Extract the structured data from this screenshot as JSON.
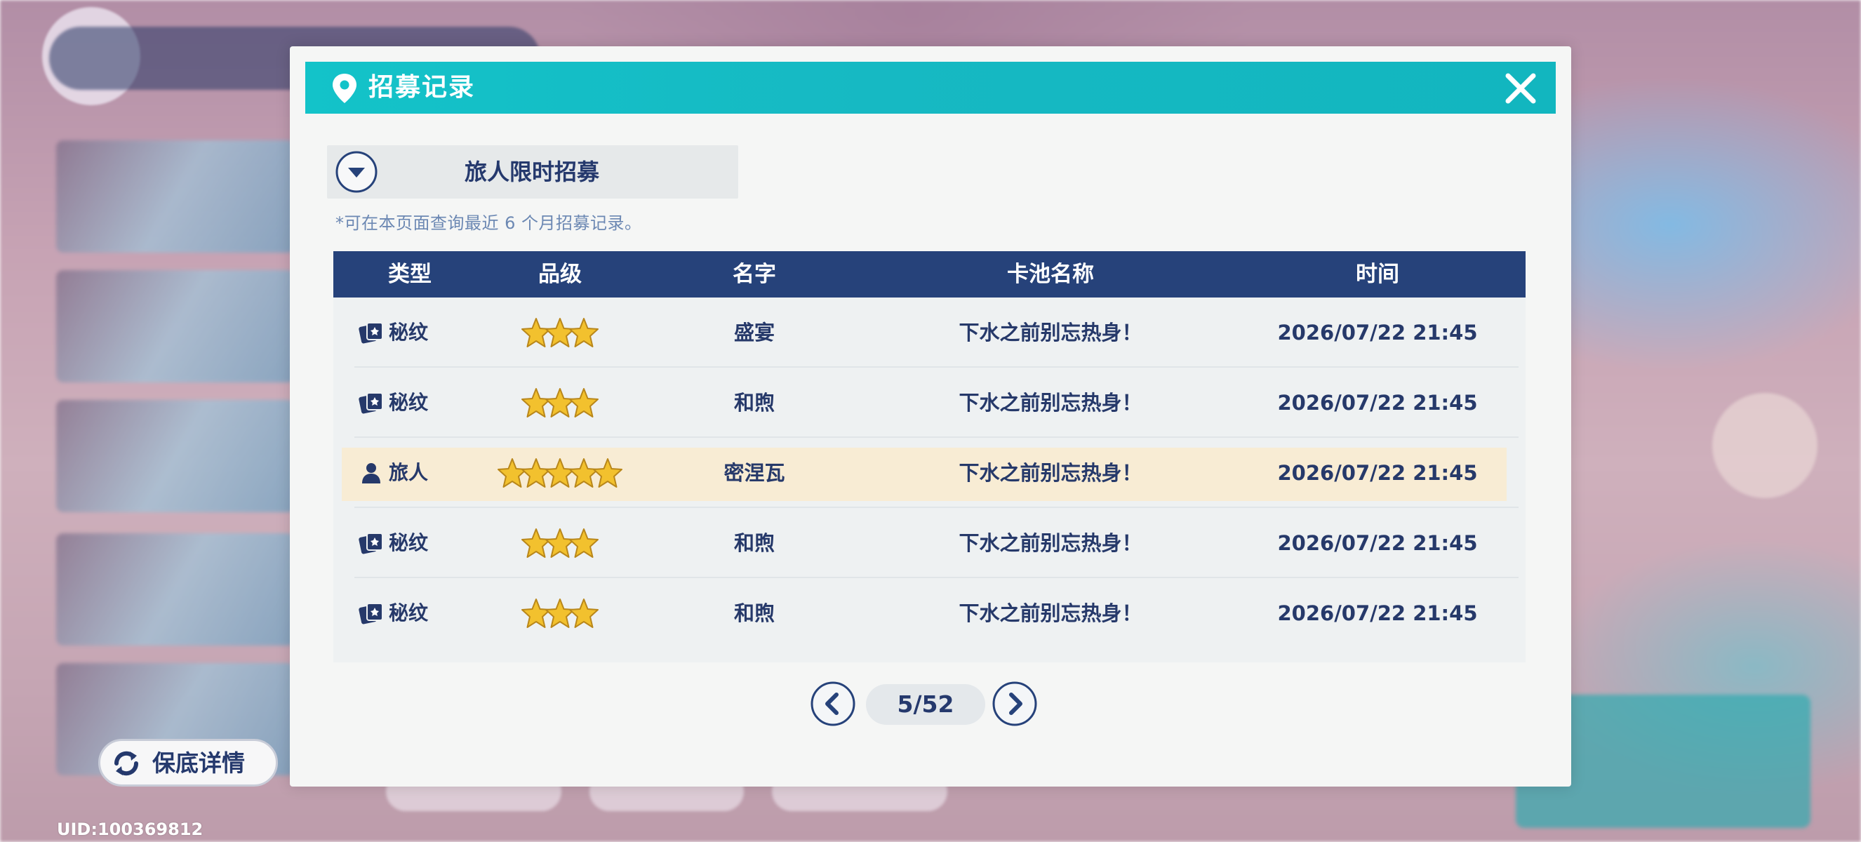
{
  "header": {
    "title": "招募记录",
    "pin_icon": "location-pin-icon",
    "close_icon": "close-icon"
  },
  "pool_selector": {
    "selected": "旅人限时招募",
    "arrow_icon": "chevron-down-icon"
  },
  "notice": "*可在本页面查询最近 6 个月招募记录。",
  "table": {
    "columns": [
      "类型",
      "品级",
      "名字",
      "卡池名称",
      "时间"
    ],
    "rows": [
      {
        "type": "秘纹",
        "type_icon": "card-icon",
        "stars": 3,
        "name": "盛宴",
        "pool": "下水之前别忘热身！",
        "time": "2026/07/22 21:45",
        "highlight": false
      },
      {
        "type": "秘纹",
        "type_icon": "card-icon",
        "stars": 3,
        "name": "和煦",
        "pool": "下水之前别忘热身！",
        "time": "2026/07/22 21:45",
        "highlight": false
      },
      {
        "type": "旅人",
        "type_icon": "person-icon",
        "stars": 5,
        "name": "密涅瓦",
        "pool": "下水之前别忘热身！",
        "time": "2026/07/22 21:45",
        "highlight": true
      },
      {
        "type": "秘纹",
        "type_icon": "card-icon",
        "stars": 3,
        "name": "和煦",
        "pool": "下水之前别忘热身！",
        "time": "2026/07/22 21:45",
        "highlight": false
      },
      {
        "type": "秘纹",
        "type_icon": "card-icon",
        "stars": 3,
        "name": "和煦",
        "pool": "下水之前别忘热身！",
        "time": "2026/07/22 21:45",
        "highlight": false
      }
    ]
  },
  "pager": {
    "page": "5/52",
    "prev_icon": "chevron-left-icon",
    "next_icon": "chevron-right-icon"
  },
  "pity_button": {
    "label": "保底详情",
    "icon": "refresh-icon"
  },
  "uid": "UID:100369812",
  "colors": {
    "header_teal": "#13c3c9",
    "table_head": "#26427a",
    "text_navy": "#26396a",
    "highlight_row": "#f8ecd4",
    "star_gold": "#f2c12e"
  }
}
